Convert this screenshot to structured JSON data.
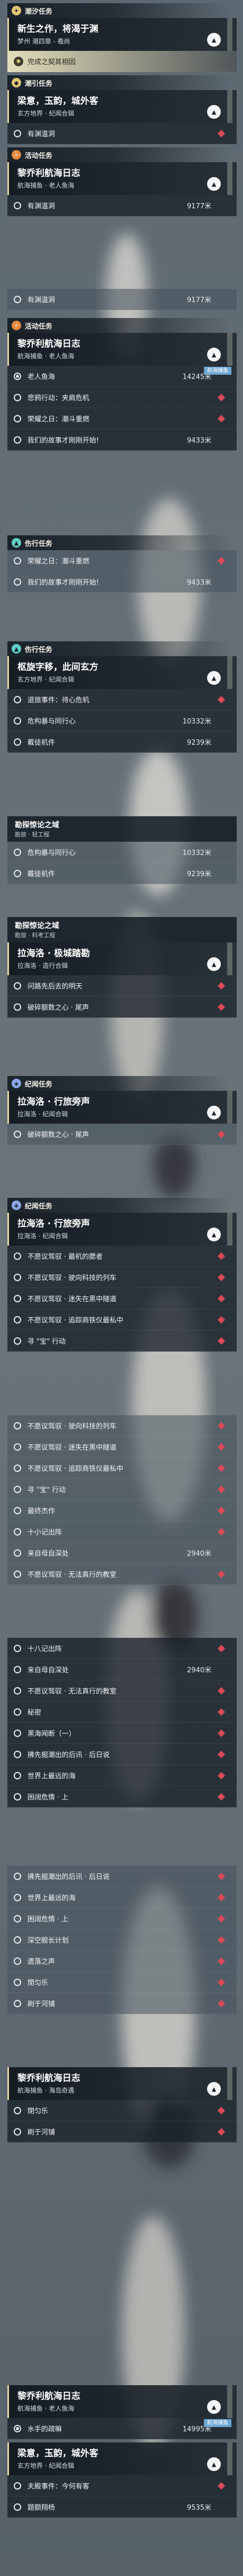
{
  "colors": {
    "accent_gold": "#e2c572",
    "accent_orange": "#e58a3f",
    "accent_teal": "#5fd0c4",
    "accent_blue": "#8aa8e6",
    "marker_red": "#d84b58",
    "badge_blue": "#6ea7d3"
  },
  "icons": {
    "category_marker": "quest-category-icon",
    "expand": "chevron-up-icon",
    "objective": "radio-circle-icon",
    "map_marker": "red-diamond-marker-icon"
  },
  "screens": [
    {
      "category": {
        "label": "潮汐任务",
        "tag": "gold",
        "glyph": "✦"
      },
      "quest": {
        "title": "新生之作，将渴于渊",
        "subtitle": "梦州 潮四章 - 羲尚"
      },
      "rows": [
        {
          "type": "highlight",
          "label": "完成之契其相因"
        }
      ]
    },
    {
      "category": {
        "label": "潮引任务",
        "tag": "gold",
        "glyph": "◆"
      },
      "quest": {
        "title": "梁意，玉韵，城外客",
        "subtitle": "玄方地界 · 纪闻合辑"
      },
      "rows": [
        {
          "type": "obj",
          "label": "有渊温洞",
          "dist": "",
          "marker": true
        }
      ]
    },
    {
      "category": {
        "label": "活动任务",
        "tag": "orange",
        "glyph": "✧"
      },
      "quest": {
        "title": "黎乔利航海日志",
        "subtitle": "航海捕鱼 · 老人鱼海"
      },
      "rows": [
        {
          "type": "obj",
          "label": "有渊温洞",
          "dist": "9177米",
          "marker": false
        }
      ]
    }
  ],
  "list1": {
    "category": {
      "label": "活动任务",
      "tag": "orange",
      "glyph": "✧"
    },
    "quest": {
      "title": "黎乔利航海日志",
      "subtitle": "航海捕鱼 · 老人鱼海"
    },
    "rows": [
      {
        "label": "老人鱼海",
        "dist": "14245米",
        "badge": "航海捕鱼",
        "marker": false,
        "on": true
      },
      {
        "label": "悲鸦行动：夹肩危机",
        "dist": "",
        "marker": true
      },
      {
        "label": "荣耀之日：潮斗重燃",
        "dist": "",
        "marker": true
      },
      {
        "label": "我们的故事才刚刚开始!",
        "dist": "9433米",
        "marker": false
      }
    ]
  },
  "list2": {
    "category": {
      "label": "伤行任务",
      "tag": "teal",
      "glyph": "▲"
    },
    "rows": [
      {
        "label": "荣耀之日：潮斗重燃",
        "dist": "",
        "marker": true
      },
      {
        "label": "我们的故事才刚刚开始!",
        "dist": "9433米",
        "marker": false
      }
    ]
  },
  "list3": {
    "category": {
      "label": "伤行任务",
      "tag": "teal",
      "glyph": "▲"
    },
    "quest": {
      "title": "枢旋字移，此间玄方",
      "subtitle": "玄方地界 · 纪闻合辑"
    },
    "rows": [
      {
        "label": "退旅事件：待心危机",
        "dist": "",
        "marker": true
      },
      {
        "label": "危构暴与同行心",
        "dist": "10332米",
        "marker": false
      },
      {
        "label": "戴徒机件",
        "dist": "9239米",
        "marker": false
      }
    ]
  },
  "list4": {
    "mini": {
      "title": "勘探惊论之域",
      "subtitle": "勘旅 · 轻工程"
    },
    "rows": [
      {
        "label": "危构暴与同行心",
        "dist": "10332米",
        "marker": false
      },
      {
        "label": "戴徒机件",
        "dist": "9239米",
        "marker": false
      }
    ]
  },
  "list5": {
    "mini": {
      "title": "勘探惊论之域",
      "subtitle": "勘旅 · 科考工程"
    },
    "quest": {
      "title": "拉海洛 · 极城踏勘",
      "subtitle": "拉海洛 · 造行合辑"
    },
    "rows": [
      {
        "label": "问路先后去的明天",
        "dist": "",
        "marker": true
      },
      {
        "label": "破碎额数之心 · 尾声",
        "dist": "",
        "marker": true
      }
    ]
  },
  "list6": {
    "category": {
      "label": "纪闻任务",
      "tag": "blue",
      "glyph": "◈"
    },
    "quest": {
      "title": "拉海洛 · 行旅旁声",
      "subtitle": "拉海洛 · 纪闻合辑"
    },
    "rows": [
      {
        "label": "破碎额数之心 · 尾声",
        "dist": "",
        "marker": true
      }
    ]
  },
  "list7": {
    "category": {
      "label": "纪闻任务",
      "tag": "blue",
      "glyph": "◈"
    },
    "quest": {
      "title": "拉海洛 · 行旅旁声",
      "subtitle": "拉海洛 · 纪闻合辑"
    },
    "rows": [
      {
        "label": "不愿议驾驭 · 最机的腮者",
        "dist": "",
        "marker": true
      },
      {
        "label": "不愿议驾驭 · 驶向科技的列车",
        "dist": "",
        "marker": true
      },
      {
        "label": "不愿议驾驭 · 迷失在黑中隧道",
        "dist": "",
        "marker": true
      },
      {
        "label": "不愿议驾驭 · 追踪商铁仪最私中",
        "dist": "",
        "marker": true
      },
      {
        "label": "寻 \"宝\" 行动",
        "dist": "",
        "marker": true
      }
    ]
  },
  "list8": {
    "rows": [
      {
        "label": "不愿议驾驭 · 驶向科技的列车",
        "dist": "",
        "marker": true
      },
      {
        "label": "不愿议驾驭 · 迷失在黑中隧道",
        "dist": "",
        "marker": true
      },
      {
        "label": "不愿议驾驭 · 追踪商铁仪最私中",
        "dist": "",
        "marker": true
      },
      {
        "label": "寻 \"宝\" 行动",
        "dist": "",
        "marker": true
      },
      {
        "label": "最终杰作",
        "dist": "",
        "marker": true
      },
      {
        "label": "十小记出阵",
        "dist": "",
        "marker": true
      },
      {
        "label": "来自母自深处",
        "dist": "2940米",
        "marker": false
      },
      {
        "label": "不愿议驾驭 · 无法真行的教室",
        "dist": "",
        "marker": true
      }
    ]
  },
  "list9": {
    "rows": [
      {
        "label": "十八记出阵",
        "dist": "",
        "marker": true
      },
      {
        "label": "来自母自深处",
        "dist": "2940米",
        "marker": false
      },
      {
        "label": "不愿议驾驭 · 无法真行的教室",
        "dist": "",
        "marker": true
      },
      {
        "label": "秘密",
        "dist": "",
        "marker": true
      },
      {
        "label": "黑海闻断（一）",
        "dist": "",
        "marker": true
      },
      {
        "label": "拂先掘潮出的后讯 · 后日说",
        "dist": "",
        "marker": true
      },
      {
        "label": "世界上最远的海",
        "dist": "",
        "marker": true
      },
      {
        "label": "困阔危情 · 上",
        "dist": "",
        "marker": true
      }
    ]
  },
  "list10": {
    "rows": [
      {
        "label": "拂先掘潮出的后讯 · 后日说",
        "dist": "",
        "marker": true
      },
      {
        "label": "世界上最远的海",
        "dist": "",
        "marker": true
      },
      {
        "label": "困阔危情 · 上",
        "dist": "",
        "marker": true
      },
      {
        "label": "深空舰长计划",
        "dist": "",
        "marker": true
      },
      {
        "label": "遗落之声",
        "dist": "",
        "marker": true
      },
      {
        "label": "閉匀乐",
        "dist": "",
        "marker": true
      },
      {
        "label": "刷于河铺",
        "dist": "",
        "marker": true
      }
    ]
  },
  "list11": {
    "quest": {
      "title": "黎乔利航海日志",
      "subtitle": "航海捕鱼 · 海岛奇遇"
    },
    "rows": [
      {
        "label": "閉匀乐",
        "dist": "",
        "marker": true
      },
      {
        "label": "刷于河铺",
        "dist": "",
        "marker": true
      }
    ]
  },
  "list12": {
    "quest": {
      "title": "黎乔利航海日志",
      "subtitle": "航海捕鱼 · 老人鱼海"
    },
    "rows": [
      {
        "label": "水手的疏嘛",
        "dist": "14995米",
        "badge": "航海捕鱼",
        "marker": false,
        "on": true
      }
    ],
    "quest2": {
      "title": "梁意，玉韵，城外客",
      "subtitle": "玄方地界 · 纪闻合辑"
    },
    "rows2": [
      {
        "label": "夫殿事件：今何有客",
        "dist": "",
        "marker": true
      },
      {
        "label": "题额翔杨",
        "dist": "9535米",
        "marker": false
      }
    ]
  }
}
